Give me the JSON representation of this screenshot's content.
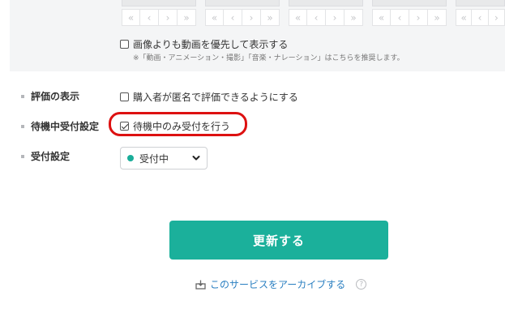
{
  "media_panel": {
    "nav_glyphs": [
      "«",
      "‹",
      "›",
      "»"
    ],
    "prefer_video_label": "画像よりも動画を優先して表示する",
    "prefer_video_checked": false,
    "prefer_video_note": "※「動画・アニメーション・撮影」「音楽・ナレーション」はこちらを推奨します。"
  },
  "rating": {
    "label": "評価の表示",
    "option_label": "購入者が匿名で評価できるようにする",
    "checked": false
  },
  "waiting": {
    "label": "待機中受付設定",
    "option_label": "待機中のみ受付を行う",
    "checked": true
  },
  "reception": {
    "label": "受付設定",
    "selected_value": "受付中",
    "status_color": "#1aad99"
  },
  "actions": {
    "update_label": "更新する",
    "archive_label": "このサービスをアーカイブする",
    "help_glyph": "?"
  },
  "colors": {
    "accent": "#1bb09b",
    "link": "#2a7fc1",
    "highlight": "#dd1111"
  }
}
